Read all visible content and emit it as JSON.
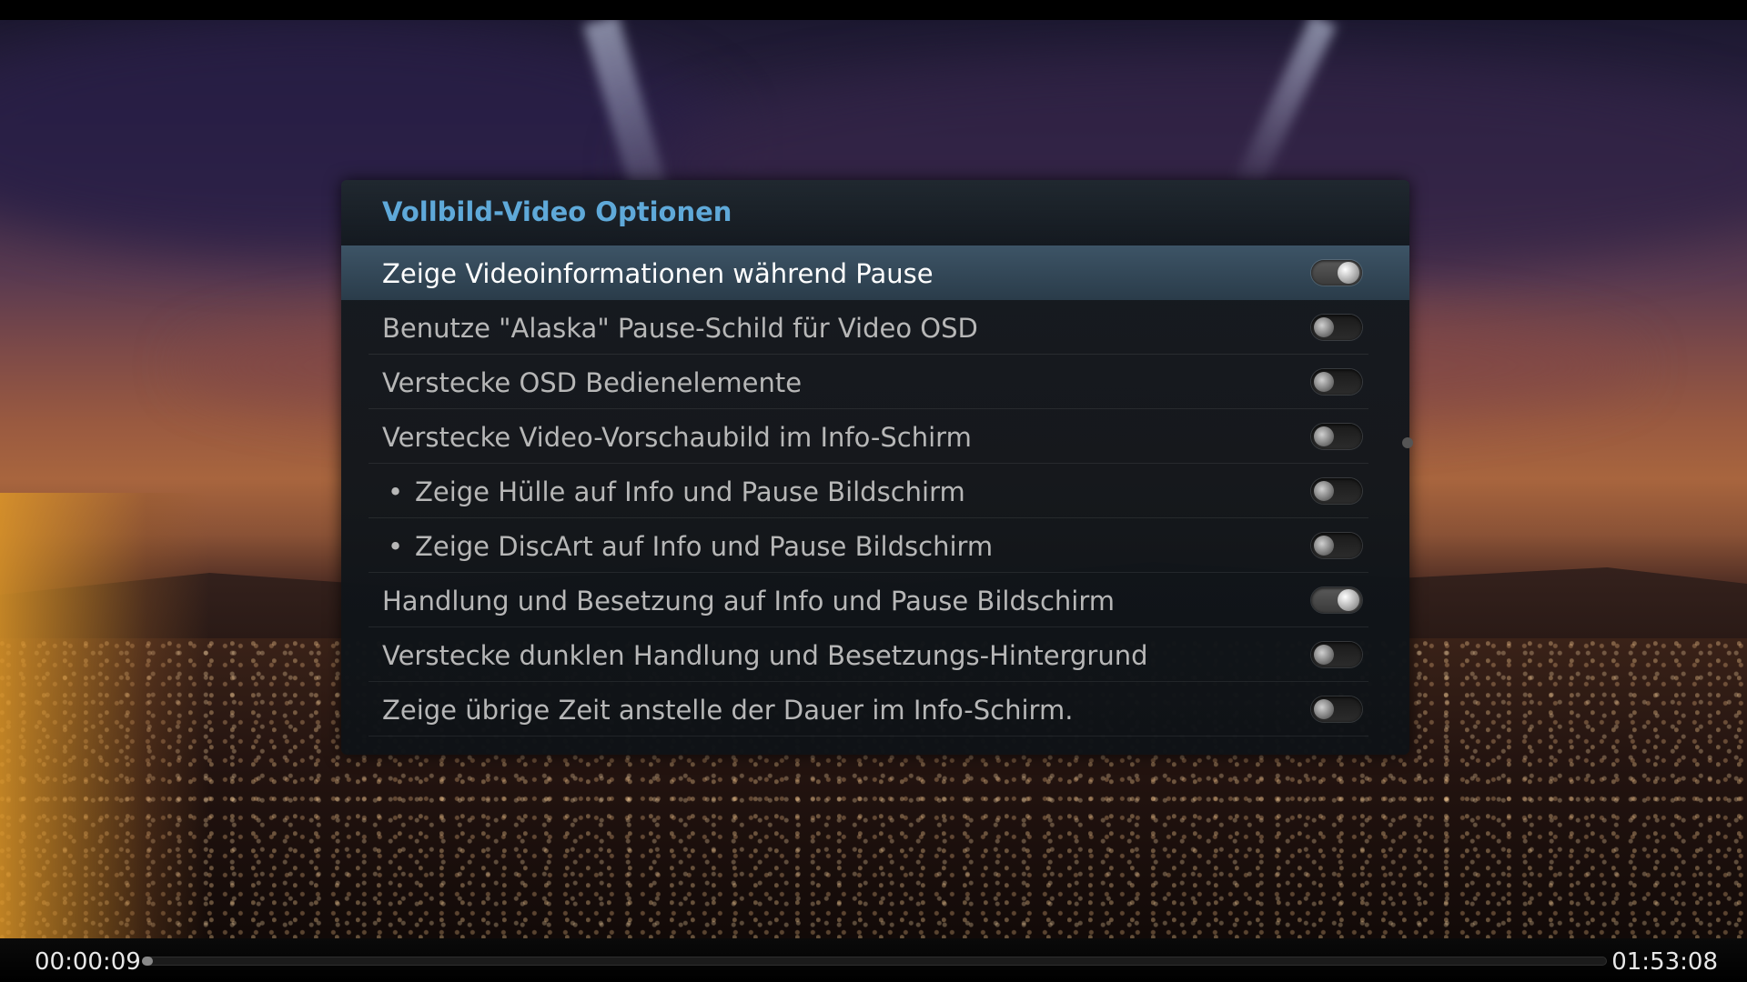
{
  "dialog": {
    "title": "Vollbild-Video Optionen",
    "options": [
      {
        "label": "Zeige Videoinformationen während Pause",
        "enabled": true,
        "focused": true,
        "sub": false
      },
      {
        "label": "Benutze \"Alaska\" Pause-Schild für Video OSD",
        "enabled": false,
        "focused": false,
        "sub": false
      },
      {
        "label": "Verstecke OSD Bedienelemente",
        "enabled": false,
        "focused": false,
        "sub": false
      },
      {
        "label": "Verstecke Video-Vorschaubild im Info-Schirm",
        "enabled": false,
        "focused": false,
        "sub": false
      },
      {
        "label": "Zeige Hülle auf Info und Pause Bildschirm",
        "enabled": false,
        "focused": false,
        "sub": true
      },
      {
        "label": "Zeige DiscArt auf Info und Pause Bildschirm",
        "enabled": false,
        "focused": false,
        "sub": true
      },
      {
        "label": "Handlung und Besetzung auf Info und Pause Bildschirm",
        "enabled": true,
        "focused": false,
        "sub": false
      },
      {
        "label": "Verstecke dunklen Handlung und Besetzungs-Hintergrund",
        "enabled": false,
        "focused": false,
        "sub": false
      },
      {
        "label": "Zeige übrige Zeit anstelle der Dauer im Info-Schirm.",
        "enabled": false,
        "focused": false,
        "sub": false
      }
    ],
    "bullet_glyph": "•"
  },
  "playback": {
    "elapsed": "00:00:09",
    "total": "01:53:08",
    "progress_fraction": 0.0013
  },
  "colors": {
    "title": "#5fa9d9",
    "focus": "#3d5466"
  }
}
